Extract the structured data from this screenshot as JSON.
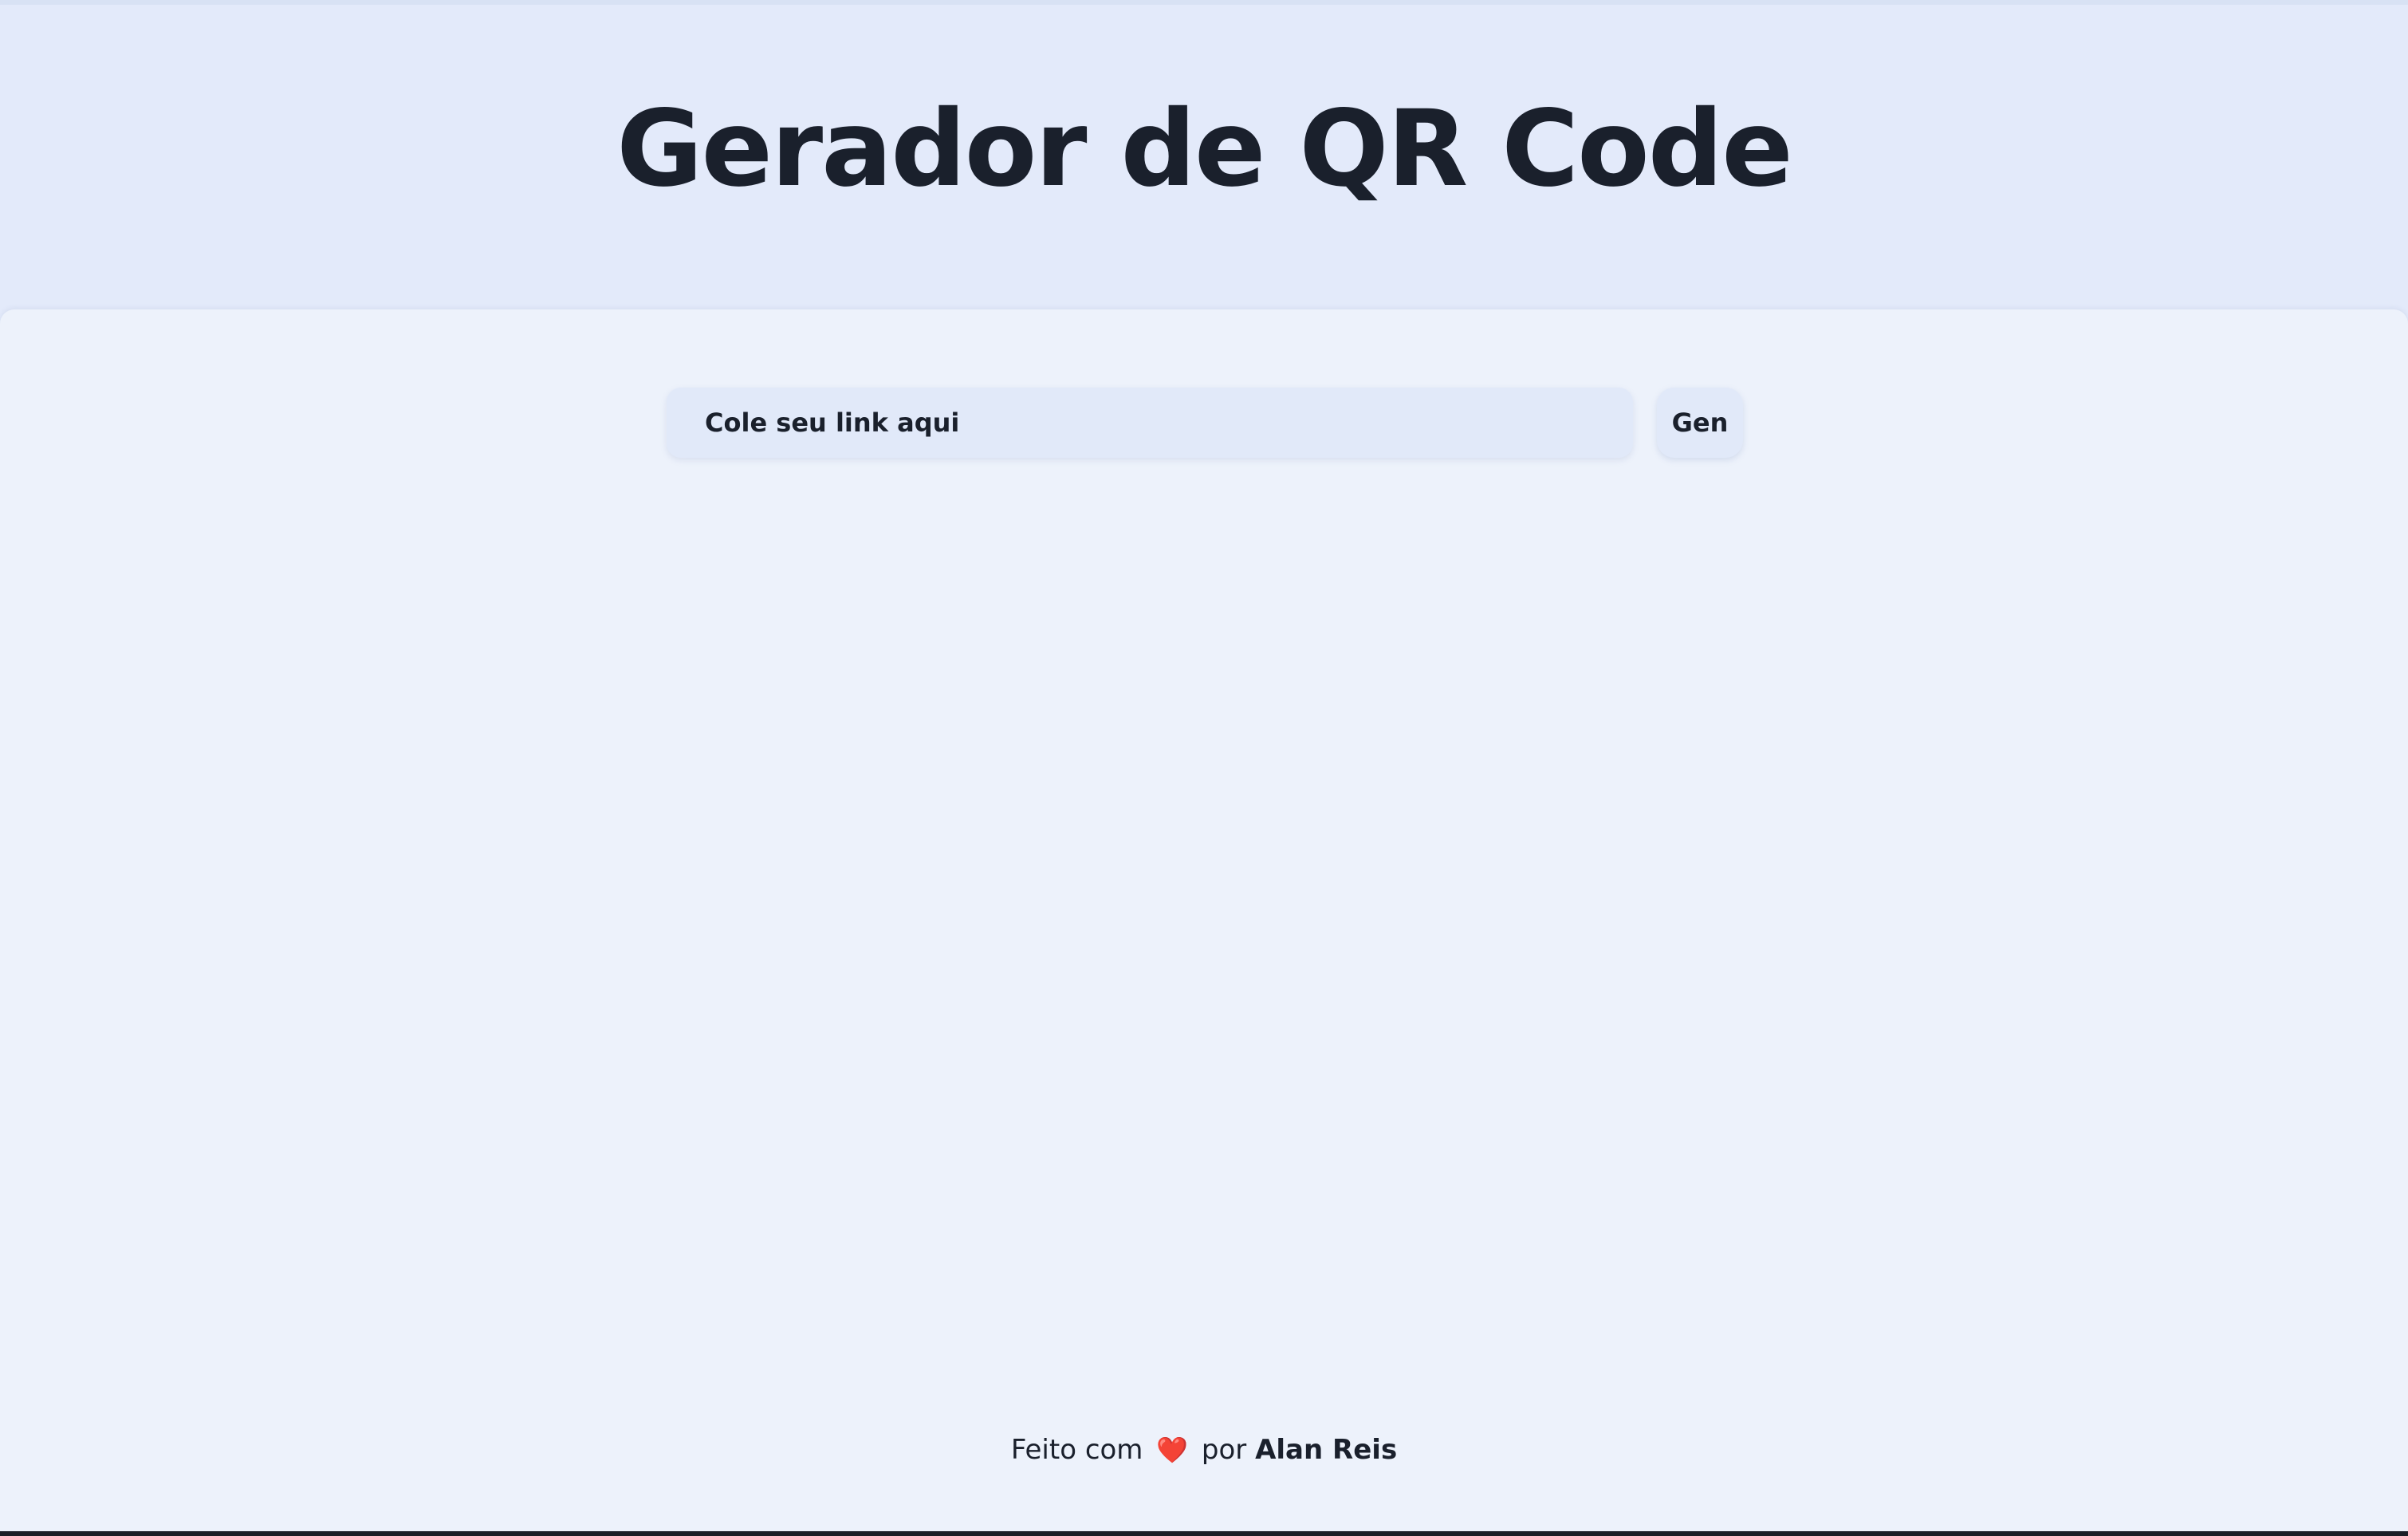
{
  "header": {
    "title": "Gerador de QR Code"
  },
  "form": {
    "input_placeholder": "Cole seu link aqui",
    "input_value": "",
    "button_label": "Gen"
  },
  "footer": {
    "made_with": "Feito com",
    "heart_icon": "heart-icon",
    "heart_glyph": "❤️",
    "by": "por",
    "author": "Alan Reis"
  },
  "colors": {
    "header_bg": "#e3eafa",
    "panel_bg": "#edf2fb",
    "text": "#1a202c",
    "input_bg": "#e1e9f9",
    "heart": "#e53935"
  }
}
